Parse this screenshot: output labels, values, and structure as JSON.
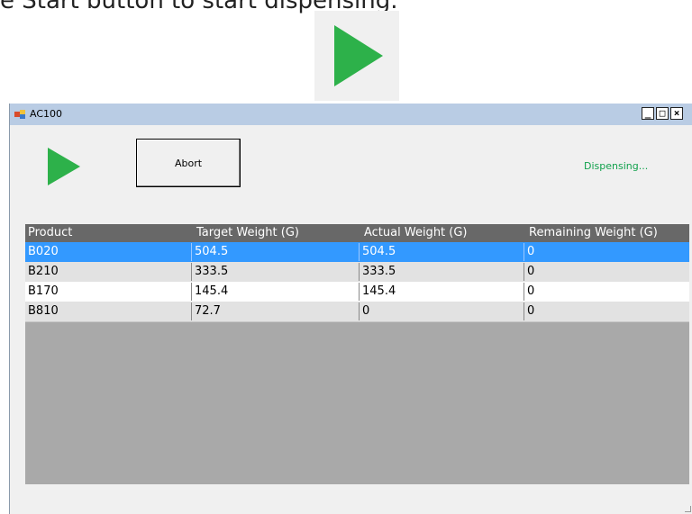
{
  "caption": "e Start button to start dispensing.",
  "window": {
    "title": "AC100",
    "controls": {
      "minimize": "_",
      "maximize": "□",
      "close": "×"
    }
  },
  "toolbar": {
    "abort_label": "Abort",
    "status": "Dispensing..."
  },
  "icons": {
    "play": "play-icon",
    "app": "app-icon",
    "accent_color": "#2db14a",
    "status_color": "#11a14c",
    "selected_color": "#3399ff"
  },
  "table": {
    "columns": [
      "Product",
      "Target Weight (G)",
      "Actual Weight (G)",
      "Remaining Weight (G)"
    ],
    "rows": [
      [
        "B020",
        "504.5",
        "504.5",
        "0"
      ],
      [
        "B210",
        "333.5",
        "333.5",
        "0"
      ],
      [
        "B170",
        "145.4",
        "145.4",
        "0"
      ],
      [
        "B810",
        "72.7",
        "0",
        "0"
      ]
    ],
    "selected_row": 0
  }
}
